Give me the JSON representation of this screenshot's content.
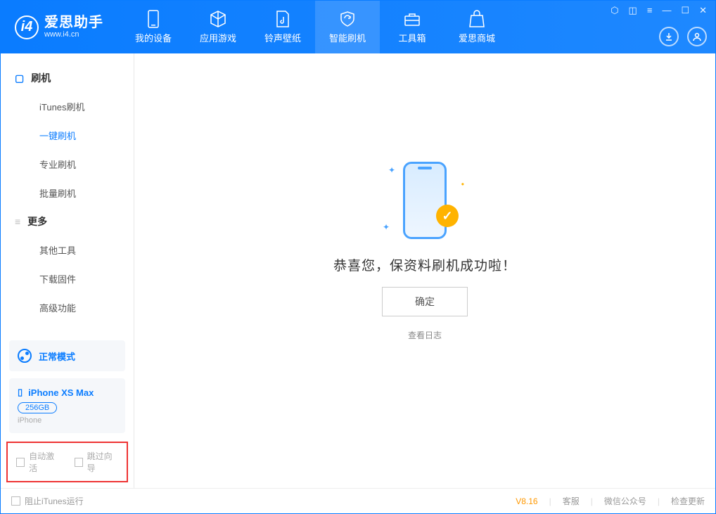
{
  "logo": {
    "title": "爱思助手",
    "subtitle": "www.i4.cn"
  },
  "nav": {
    "items": [
      {
        "label": "我的设备"
      },
      {
        "label": "应用游戏"
      },
      {
        "label": "铃声壁纸"
      },
      {
        "label": "智能刷机"
      },
      {
        "label": "工具箱"
      },
      {
        "label": "爱思商城"
      }
    ]
  },
  "sidebar": {
    "group1_title": "刷机",
    "items1": [
      {
        "label": "iTunes刷机"
      },
      {
        "label": "一键刷机"
      },
      {
        "label": "专业刷机"
      },
      {
        "label": "批量刷机"
      }
    ],
    "group2_title": "更多",
    "items2": [
      {
        "label": "其他工具"
      },
      {
        "label": "下载固件"
      },
      {
        "label": "高级功能"
      }
    ]
  },
  "mode": {
    "label": "正常模式"
  },
  "device": {
    "name": "iPhone XS Max",
    "capacity": "256GB",
    "type": "iPhone"
  },
  "options": {
    "auto_activate": "自动激活",
    "skip_guide": "跳过向导"
  },
  "main": {
    "success_text": "恭喜您，保资料刷机成功啦！",
    "ok_button": "确定",
    "view_log": "查看日志"
  },
  "footer": {
    "block_itunes": "阻止iTunes运行",
    "version": "V8.16",
    "service": "客服",
    "wechat": "微信公众号",
    "update": "检查更新"
  }
}
